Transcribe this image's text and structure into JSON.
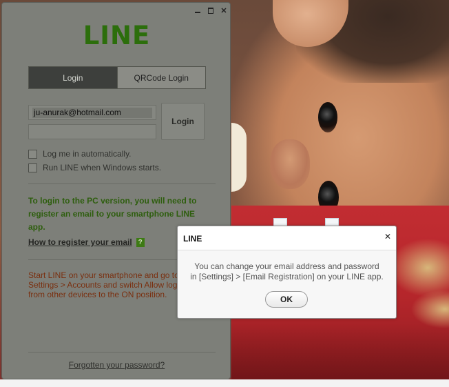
{
  "window": {
    "logo": "LINE",
    "tabs": [
      {
        "label": "Login"
      },
      {
        "label": "QRCode Login"
      }
    ],
    "email_value": "ju-anurak@hotmail.com",
    "password_value": "",
    "login_button": "Login",
    "checkboxes": [
      {
        "label": "Log me in automatically.",
        "checked": false
      },
      {
        "label": "Run LINE when Windows starts.",
        "checked": false
      }
    ],
    "info_text": "To login to the PC version, you will need to register an email to your smartphone LINE app.",
    "register_link": "How to register your email",
    "help_icon_text": "?",
    "instruction_text": "Start LINE on your smartphone and go to Settings > Accounts and switch Allow login from other devices to the ON position.",
    "forgot_link": "Forgotten your password?",
    "colors": {
      "logo": "#2c6e0c",
      "info_text": "#2e5e0e",
      "instruction_text": "#7a3010"
    }
  },
  "dialog": {
    "title": "LINE",
    "message_line1": "You can change your email address and password",
    "message_line2": "in [Settings] > [Email Registration] on your LINE app.",
    "ok_button": "OK"
  }
}
